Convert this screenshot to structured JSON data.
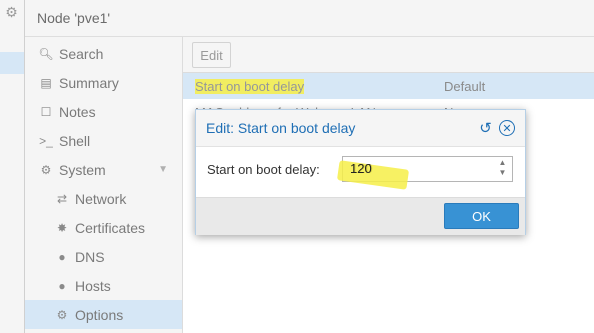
{
  "header": {
    "title": "Node 'pve1'"
  },
  "nav": {
    "items": [
      {
        "label": "Search",
        "icon": "search-icon"
      },
      {
        "label": "Summary",
        "icon": "book-icon"
      },
      {
        "label": "Notes",
        "icon": "note-icon"
      },
      {
        "label": "Shell",
        "icon": "terminal-icon"
      },
      {
        "label": "System",
        "icon": "gears-icon"
      },
      {
        "label": "Network",
        "icon": "exchange-icon"
      },
      {
        "label": "Certificates",
        "icon": "certificate-icon"
      },
      {
        "label": "DNS",
        "icon": "globe-icon"
      },
      {
        "label": "Hosts",
        "icon": "globe-icon"
      },
      {
        "label": "Options",
        "icon": "gear-icon"
      }
    ],
    "selected": "Options"
  },
  "toolbar": {
    "edit_label": "Edit"
  },
  "options_grid": {
    "rows": [
      {
        "name": "Start on boot delay",
        "value": "Default"
      },
      {
        "name": "MAC address for Wake on LAN",
        "value": "None"
      },
      {
        "name": "",
        "value": ""
      }
    ]
  },
  "dialog": {
    "title": "Edit: Start on boot delay",
    "field_label": "Start on boot delay:",
    "field_value": "120",
    "ok_label": "OK"
  },
  "colors": {
    "accent": "#3892d4",
    "selection": "#d6e7f6",
    "highlight": "#f6ef48",
    "title": "#1f6fb5"
  }
}
